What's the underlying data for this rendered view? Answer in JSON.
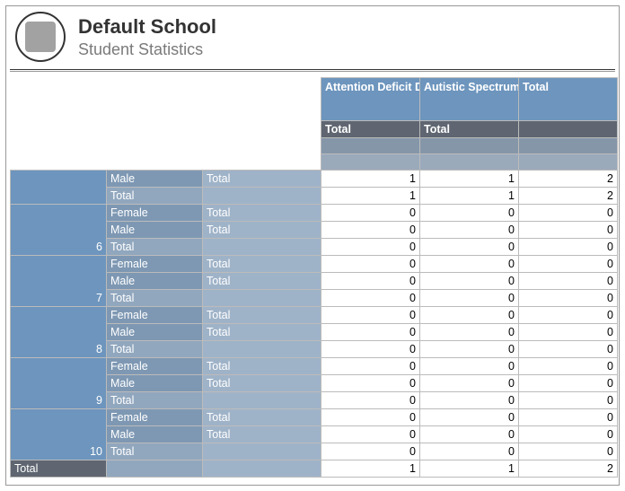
{
  "header": {
    "school_name": "Default School",
    "report_name": "Student Statistics"
  },
  "columns": {
    "c1": "Attention Deficit Disorder",
    "c2": "Autistic Spectrum Disorder",
    "c3": "Total",
    "sub": "Total"
  },
  "labels": {
    "male": "Male",
    "female": "Female",
    "total": "Total"
  },
  "first_group": {
    "male": {
      "sub": "Total",
      "v": [
        1,
        1,
        2
      ]
    },
    "total": {
      "v": [
        1,
        1,
        2
      ]
    }
  },
  "groups": [
    {
      "key": "6",
      "female": {
        "sub": "Total",
        "v": [
          0,
          0,
          0
        ]
      },
      "male": {
        "sub": "Total",
        "v": [
          0,
          0,
          0
        ]
      },
      "total": {
        "v": [
          0,
          0,
          0
        ]
      }
    },
    {
      "key": "7",
      "female": {
        "sub": "Total",
        "v": [
          0,
          0,
          0
        ]
      },
      "male": {
        "sub": "Total",
        "v": [
          0,
          0,
          0
        ]
      },
      "total": {
        "v": [
          0,
          0,
          0
        ]
      }
    },
    {
      "key": "8",
      "female": {
        "sub": "Total",
        "v": [
          0,
          0,
          0
        ]
      },
      "male": {
        "sub": "Total",
        "v": [
          0,
          0,
          0
        ]
      },
      "total": {
        "v": [
          0,
          0,
          0
        ]
      }
    },
    {
      "key": "9",
      "female": {
        "sub": "Total",
        "v": [
          0,
          0,
          0
        ]
      },
      "male": {
        "sub": "Total",
        "v": [
          0,
          0,
          0
        ]
      },
      "total": {
        "v": [
          0,
          0,
          0
        ]
      }
    },
    {
      "key": "10",
      "female": {
        "sub": "Total",
        "v": [
          0,
          0,
          0
        ]
      },
      "male": {
        "sub": "Total",
        "v": [
          0,
          0,
          0
        ]
      },
      "total": {
        "v": [
          0,
          0,
          0
        ]
      }
    }
  ],
  "grand_total": {
    "label": "Total",
    "v": [
      1,
      1,
      2
    ]
  },
  "chart_data": {
    "type": "table",
    "title": "Student Statistics",
    "columns": [
      "Attention Deficit Disorder",
      "Autistic Spectrum Disorder",
      "Total"
    ],
    "rows": [
      {
        "group": "",
        "gender": "Male",
        "values": [
          1,
          1,
          2
        ]
      },
      {
        "group": "",
        "gender": "Total",
        "values": [
          1,
          1,
          2
        ]
      },
      {
        "group": "6",
        "gender": "Female",
        "values": [
          0,
          0,
          0
        ]
      },
      {
        "group": "6",
        "gender": "Male",
        "values": [
          0,
          0,
          0
        ]
      },
      {
        "group": "6",
        "gender": "Total",
        "values": [
          0,
          0,
          0
        ]
      },
      {
        "group": "7",
        "gender": "Female",
        "values": [
          0,
          0,
          0
        ]
      },
      {
        "group": "7",
        "gender": "Male",
        "values": [
          0,
          0,
          0
        ]
      },
      {
        "group": "7",
        "gender": "Total",
        "values": [
          0,
          0,
          0
        ]
      },
      {
        "group": "8",
        "gender": "Female",
        "values": [
          0,
          0,
          0
        ]
      },
      {
        "group": "8",
        "gender": "Male",
        "values": [
          0,
          0,
          0
        ]
      },
      {
        "group": "8",
        "gender": "Total",
        "values": [
          0,
          0,
          0
        ]
      },
      {
        "group": "9",
        "gender": "Female",
        "values": [
          0,
          0,
          0
        ]
      },
      {
        "group": "9",
        "gender": "Male",
        "values": [
          0,
          0,
          0
        ]
      },
      {
        "group": "9",
        "gender": "Total",
        "values": [
          0,
          0,
          0
        ]
      },
      {
        "group": "10",
        "gender": "Female",
        "values": [
          0,
          0,
          0
        ]
      },
      {
        "group": "10",
        "gender": "Male",
        "values": [
          0,
          0,
          0
        ]
      },
      {
        "group": "10",
        "gender": "Total",
        "values": [
          0,
          0,
          0
        ]
      }
    ],
    "grand_total": [
      1,
      1,
      2
    ]
  }
}
